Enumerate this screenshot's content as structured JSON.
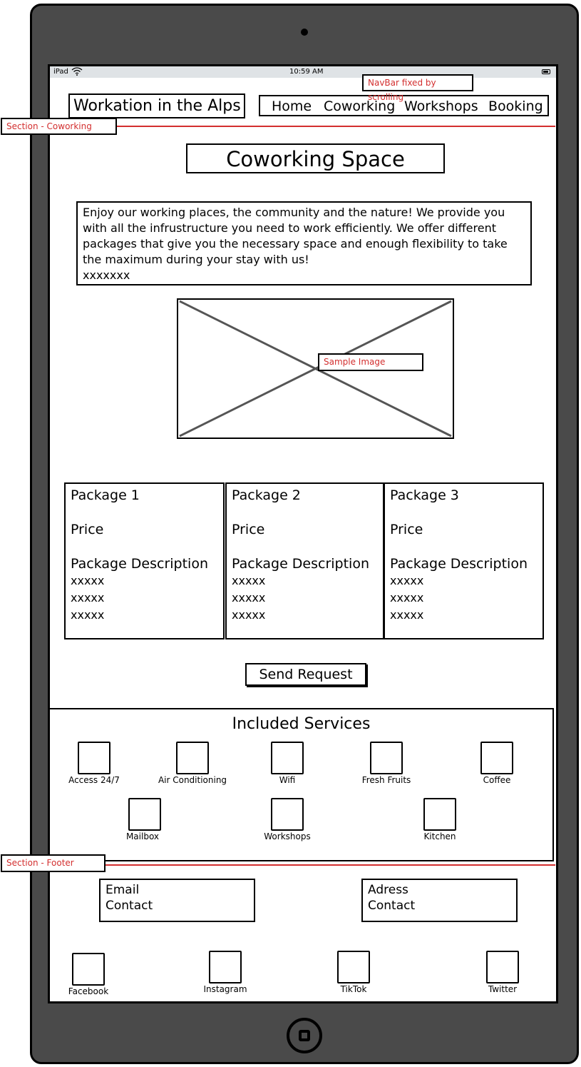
{
  "status_bar": {
    "carrier": "iPad",
    "time": "10:59 AM"
  },
  "header": {
    "site_title": "Workation in the Alps",
    "nav": [
      {
        "label": "Home"
      },
      {
        "label": "Coworking"
      },
      {
        "label": "Workshops"
      },
      {
        "label": "Booking"
      }
    ]
  },
  "annotations": {
    "navbar_note": "NavBar fixed by scrolling",
    "section_coworking": "Section - Coworking",
    "section_footer": "Section - Footer",
    "image_note": "Sample Image",
    "color": "#d32f2f"
  },
  "main": {
    "title": "Coworking Space",
    "intro_text": "Enjoy our working places, the community and the nature! We provide you with all the infrustructure you need to work efficiently. We offer different packages that give you the necessary space and enough flexibility to take the maximum during your stay with us!",
    "intro_filler": "xxxxxxx",
    "packages": [
      {
        "name": "Package 1",
        "price": "Price",
        "description": "Package Description",
        "lines": [
          "xxxxx",
          "xxxxx",
          "xxxxx"
        ]
      },
      {
        "name": "Package 2",
        "price": "Price",
        "description": "Package Description",
        "lines": [
          "xxxxx",
          "xxxxx",
          "xxxxx"
        ]
      },
      {
        "name": "Package 3",
        "price": "Price",
        "description": "Package Description",
        "lines": [
          "xxxxx",
          "xxxxx",
          "xxxxx"
        ]
      }
    ],
    "send_button": "Send Request"
  },
  "services": {
    "title": "Included Services",
    "items": [
      {
        "label": "Access 24/7"
      },
      {
        "label": "Air Conditioning"
      },
      {
        "label": "Wifi"
      },
      {
        "label": "Fresh Fruits"
      },
      {
        "label": "Coffee"
      },
      {
        "label": "Mailbox"
      },
      {
        "label": "Workshops"
      },
      {
        "label": "Kitchen"
      }
    ]
  },
  "footer": {
    "email_box": {
      "line1": "Email",
      "line2": "Contact"
    },
    "address_box": {
      "line1": "Adress",
      "line2": "Contact"
    },
    "social": [
      {
        "label": "Facebook"
      },
      {
        "label": "Instagram"
      },
      {
        "label": "TikTok"
      },
      {
        "label": "Twitter"
      }
    ]
  }
}
